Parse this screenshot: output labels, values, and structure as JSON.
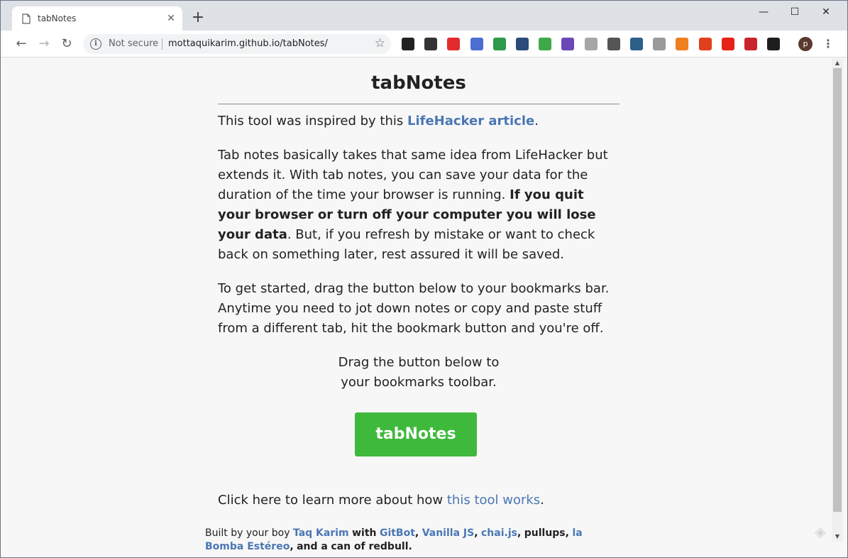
{
  "browser": {
    "tab_title": "tabNotes",
    "not_secure": "Not secure",
    "url": "mottaquikarim.github.io/tabNotes/",
    "avatar_letter": "p",
    "extensions": [
      {
        "name": "ext-1-icon",
        "color": "#222222"
      },
      {
        "name": "ext-2-icon",
        "color": "#333333"
      },
      {
        "name": "opera-icon",
        "color": "#e32b2b"
      },
      {
        "name": "calendar-icon",
        "color": "#4a6fd1"
      },
      {
        "name": "ext-5-icon",
        "color": "#2e9a4a"
      },
      {
        "name": "feedly-icon",
        "color": "#2b4b7a"
      },
      {
        "name": "plus-ext-icon",
        "color": "#3fa84a"
      },
      {
        "name": "flask-icon",
        "color": "#6b47b8"
      },
      {
        "name": "rss-icon",
        "color": "#a6a6a6"
      },
      {
        "name": "bulb-icon",
        "color": "#555555"
      },
      {
        "name": "ext-11-icon",
        "color": "#2d5f8a"
      },
      {
        "name": "mic-icon",
        "color": "#9a9a9a"
      },
      {
        "name": "ext-13-icon",
        "color": "#f07f1e"
      },
      {
        "name": "vivaldi-icon",
        "color": "#e0401c"
      },
      {
        "name": "youtube-icon",
        "color": "#e62117"
      },
      {
        "name": "bird-icon",
        "color": "#c9252c"
      },
      {
        "name": "fox-icon",
        "color": "#1e1e1e"
      }
    ]
  },
  "page": {
    "title": "tabNotes",
    "p1_prefix": "This tool was inspired by this ",
    "p1_link": "LifeHacker article",
    "p1_suffix": ".",
    "p2_start": "Tab notes basically takes that same idea from LifeHacker but extends it. With tab notes, you can save your data for the duration of the time your browser is running. ",
    "p2_bold": "If you quit your browser or turn off your computer you will lose your data",
    "p2_end": ". But, if you refresh by mistake or want to check back on something later, rest assured it will be saved.",
    "p3": "To get started, drag the button below to your bookmarks bar. Anytime you need to jot down notes or copy and paste stuff from a different tab, hit the bookmark button and you're off.",
    "drag_line1": "Drag the button below to",
    "drag_line2": "your bookmarks toolbar.",
    "button_label": "tabNotes",
    "learn_prefix": "Click here to learn more about how ",
    "learn_link": "this tool works",
    "learn_suffix": "."
  },
  "footer": {
    "built_by": "Built by your boy",
    "author": "Taq Karim",
    "with": "with",
    "gitbot": "GitBot",
    "vanilla": "Vanilla JS",
    "chai": "chai.js",
    "pullups": "pullups",
    "la_bomba": "la Bomba Estéreo",
    "and_a": "and a",
    "redbull": "can of redbull."
  }
}
